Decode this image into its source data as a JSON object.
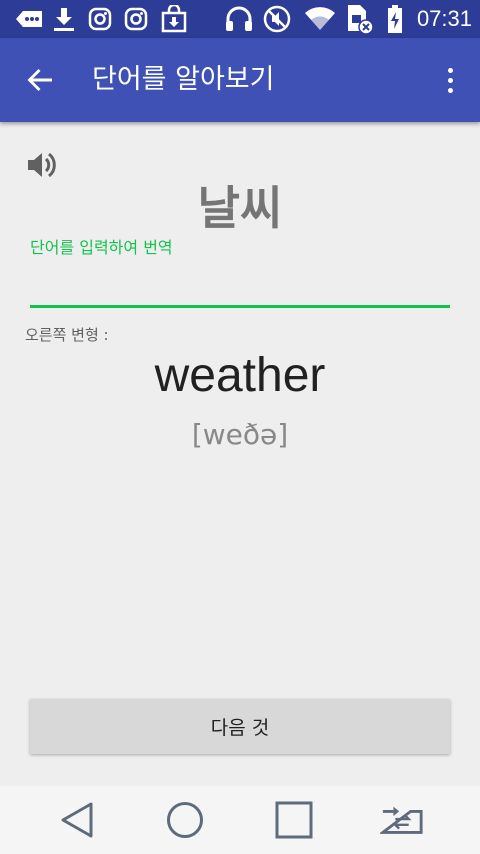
{
  "status_bar": {
    "time": "07:31",
    "icons": [
      "messages-icon",
      "download-icon",
      "instagram-icon",
      "instagram-icon",
      "store-download-icon",
      "headphones-icon",
      "mute-icon",
      "wifi-icon",
      "sim-error-icon",
      "battery-charging-icon"
    ]
  },
  "app_bar": {
    "title": "단어를 알아보기",
    "back_icon": "arrow-back-icon",
    "more_icon": "more-vert-icon"
  },
  "main": {
    "speaker_icon": "volume-icon",
    "word": "날씨",
    "input": {
      "label": "단어를 입력하여 번역",
      "value": ""
    },
    "variant_label": "오른쪽 변형 :",
    "translation": "weather",
    "phonetic": "[weðə]",
    "next_button": "다음 것"
  },
  "nav_bar": {
    "icons": [
      "back-triangle-icon",
      "home-circle-icon",
      "recents-square-icon",
      "switch-app-icon"
    ]
  },
  "colors": {
    "status_bar": "#2d3c96",
    "app_bar": "#3f51b5",
    "accent": "#14c34d",
    "background": "#eeeeee"
  }
}
